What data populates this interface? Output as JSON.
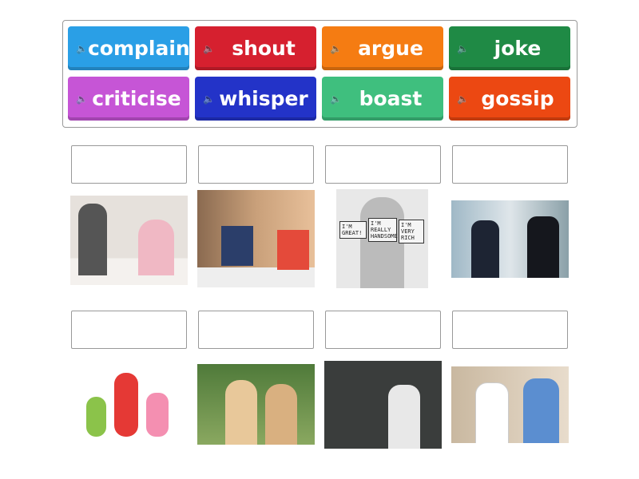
{
  "tiles": [
    {
      "label": "complain",
      "color": "#2a9fe6"
    },
    {
      "label": "shout",
      "color": "#d6202f"
    },
    {
      "label": "argue",
      "color": "#f57c12"
    },
    {
      "label": "joke",
      "color": "#1f8a45"
    },
    {
      "label": "criticise",
      "color": "#c655d6"
    },
    {
      "label": "whisper",
      "color": "#2333c8"
    },
    {
      "label": "boast",
      "color": "#3fbf7e"
    },
    {
      "label": "gossip",
      "color": "#ec4812"
    }
  ],
  "speaker_icon": "speaker-icon",
  "cartoon_text": [
    "I'M GREAT!",
    "I'M REALLY HANDSOME",
    "I'M VERY RICH"
  ]
}
